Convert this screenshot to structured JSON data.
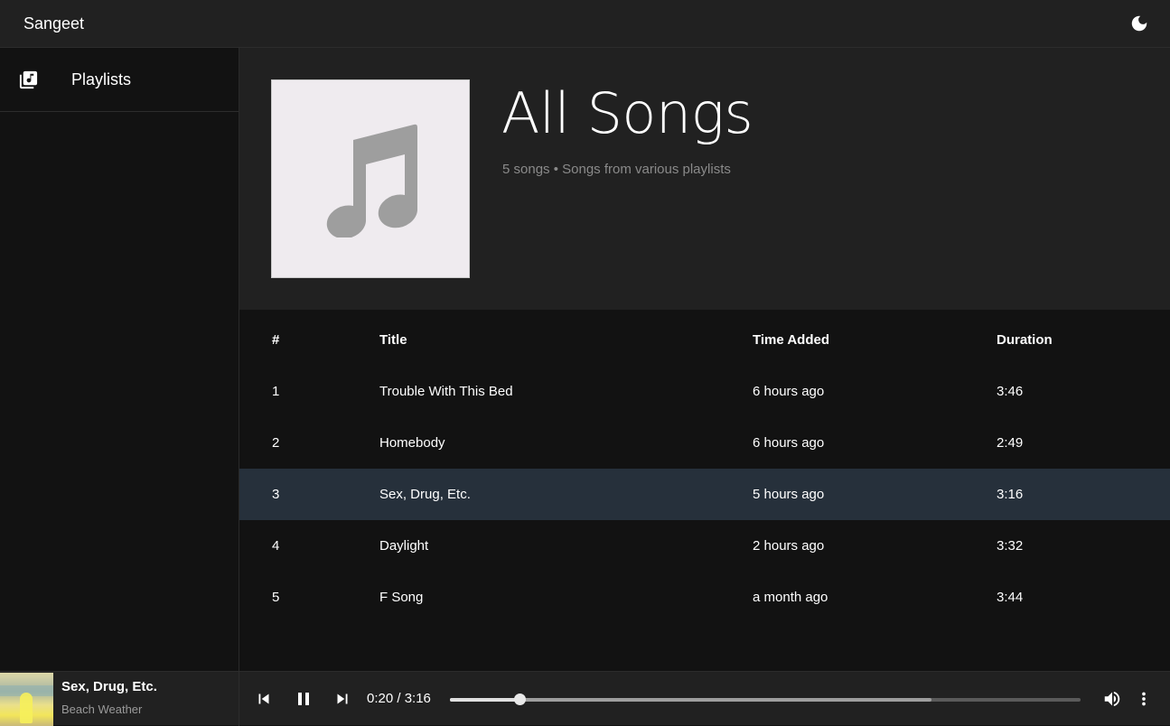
{
  "app": {
    "title": "Sangeet"
  },
  "sidebar": {
    "items": [
      {
        "label": "Playlists",
        "icon": "library-music-icon"
      }
    ]
  },
  "playlist": {
    "title": "All Songs",
    "subtitle": "5 songs • Songs from various playlists",
    "cover_icon": "music-note-icon"
  },
  "table": {
    "headers": {
      "num": "#",
      "title": "Title",
      "added": "Time Added",
      "duration": "Duration"
    },
    "rows": [
      {
        "num": "1",
        "title": "Trouble With This Bed",
        "added": "6 hours ago",
        "duration": "3:46",
        "active": false
      },
      {
        "num": "2",
        "title": "Homebody",
        "added": "6 hours ago",
        "duration": "2:49",
        "active": false
      },
      {
        "num": "3",
        "title": "Sex, Drug, Etc.",
        "added": "5 hours ago",
        "duration": "3:16",
        "active": true
      },
      {
        "num": "4",
        "title": "Daylight",
        "added": "2 hours ago",
        "duration": "3:32",
        "active": false
      },
      {
        "num": "5",
        "title": "F Song",
        "added": "a month ago",
        "duration": "3:44",
        "active": false
      }
    ]
  },
  "player": {
    "title": "Sex, Drug, Etc.",
    "artist": "Beach Weather",
    "time": "0:20 / 3:16",
    "progress": 0.11,
    "buffered": 0.763
  },
  "colors": {
    "active_row": "#26303b",
    "topbar": "#212121",
    "background": "#121212"
  }
}
